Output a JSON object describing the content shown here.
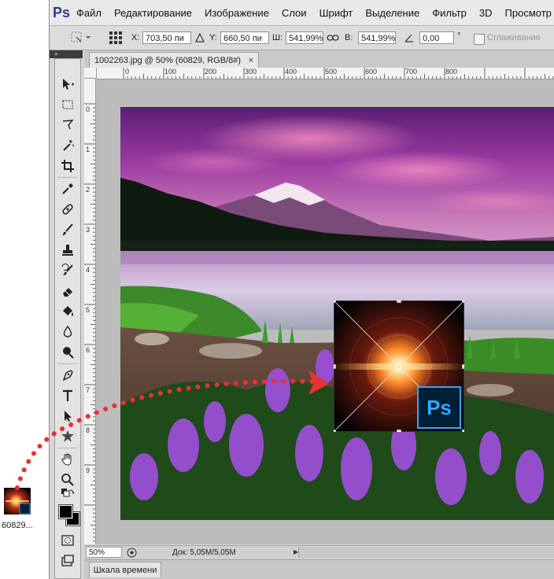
{
  "app": {
    "logo": "Ps"
  },
  "menu": [
    "Файл",
    "Редактирование",
    "Изображение",
    "Слои",
    "Шрифт",
    "Выделение",
    "Фильтр",
    "3D",
    "Просмотр"
  ],
  "options": {
    "x_label": "X:",
    "x_value": "703,50 пи",
    "y_label": "Y:",
    "y_value": "660,50 пи",
    "w_label": "Ш:",
    "w_value": "541,99%",
    "h_label": "В:",
    "h_value": "541,99%",
    "angle_value": "0,00",
    "degree": "°",
    "smoothing_label": "Сглаживание"
  },
  "document": {
    "tab_title": "1002263.jpg @ 50% (60829, RGB/8#)",
    "close": "×"
  },
  "ruler_h": [
    "0",
    "100",
    "200",
    "300",
    "400",
    "500",
    "600",
    "700",
    "800"
  ],
  "ruler_v": [
    "0",
    "1",
    "2",
    "3",
    "4",
    "5",
    "6",
    "7",
    "8",
    "9"
  ],
  "status": {
    "zoom": "50%",
    "doc_size": "Док: 5,05M/5,05M",
    "arrow": "▶"
  },
  "timeline": {
    "label": "Шкала времени"
  },
  "desktop_icon": {
    "label": "60829...",
    "badge": "Ps"
  },
  "placed_layer": {
    "badge": "Ps"
  },
  "colors": {
    "ps_blue": "#31a8ff",
    "ps_dark": "#001e36",
    "dots": "#e63232"
  }
}
